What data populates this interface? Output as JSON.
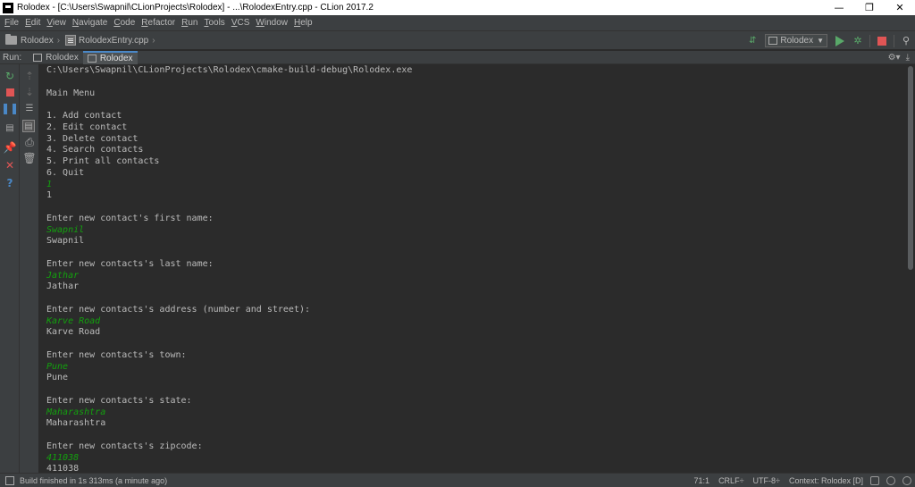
{
  "window": {
    "title": "Rolodex - [C:\\Users\\Swapnil\\CLionProjects\\Rolodex] - ...\\RolodexEntry.cpp - CLion 2017.2",
    "minimize": "—",
    "maximize": "❐",
    "close": "✕"
  },
  "menu": [
    "File",
    "Edit",
    "View",
    "Navigate",
    "Code",
    "Refactor",
    "Run",
    "Tools",
    "VCS",
    "Window",
    "Help"
  ],
  "navbar": {
    "project": "Rolodex",
    "file": "RolodexEntry.cpp",
    "run_config": "Rolodex"
  },
  "runbar": {
    "label": "Run:",
    "tabs": [
      "Rolodex",
      "Rolodex"
    ],
    "active_tab": 1
  },
  "console": {
    "lines": [
      {
        "text": "C:\\Users\\Swapnil\\CLionProjects\\Rolodex\\cmake-build-debug\\Rolodex.exe",
        "input": false
      },
      {
        "text": "",
        "input": false
      },
      {
        "text": "Main Menu",
        "input": false
      },
      {
        "text": "",
        "input": false
      },
      {
        "text": "1. Add contact",
        "input": false
      },
      {
        "text": "2. Edit contact",
        "input": false
      },
      {
        "text": "3. Delete contact",
        "input": false
      },
      {
        "text": "4. Search contacts",
        "input": false
      },
      {
        "text": "5. Print all contacts",
        "input": false
      },
      {
        "text": "6. Quit",
        "input": false
      },
      {
        "text": "1",
        "input": true
      },
      {
        "text": "1",
        "input": false
      },
      {
        "text": "",
        "input": false
      },
      {
        "text": "Enter new contact's first name:",
        "input": false
      },
      {
        "text": "Swapnil",
        "input": true
      },
      {
        "text": "Swapnil",
        "input": false
      },
      {
        "text": "",
        "input": false
      },
      {
        "text": "Enter new contacts's last name:",
        "input": false
      },
      {
        "text": "Jathar",
        "input": true
      },
      {
        "text": "Jathar",
        "input": false
      },
      {
        "text": "",
        "input": false
      },
      {
        "text": "Enter new contacts's address (number and street):",
        "input": false
      },
      {
        "text": "Karve Road",
        "input": true
      },
      {
        "text": "Karve Road",
        "input": false
      },
      {
        "text": "",
        "input": false
      },
      {
        "text": "Enter new contacts's town:",
        "input": false
      },
      {
        "text": "Pune",
        "input": true
      },
      {
        "text": "Pune",
        "input": false
      },
      {
        "text": "",
        "input": false
      },
      {
        "text": "Enter new contacts's state:",
        "input": false
      },
      {
        "text": "Maharashtra",
        "input": true
      },
      {
        "text": "Maharashtra",
        "input": false
      },
      {
        "text": "",
        "input": false
      },
      {
        "text": "Enter new contacts's zipcode:",
        "input": false
      },
      {
        "text": "411038",
        "input": true
      },
      {
        "text": "411038",
        "input": false
      }
    ]
  },
  "statusbar": {
    "message": "Build finished in 1s 313ms (a minute ago)",
    "position": "71:1",
    "line_sep": "CRLF÷",
    "encoding": "UTF-8÷",
    "context": "Context: Rolodex [D]"
  },
  "colors": {
    "input_text": "#13a10e",
    "console_text": "#bbbbbb",
    "run_green": "#59a869",
    "stop_red": "#e05555",
    "accent_blue": "#4a88c7"
  }
}
